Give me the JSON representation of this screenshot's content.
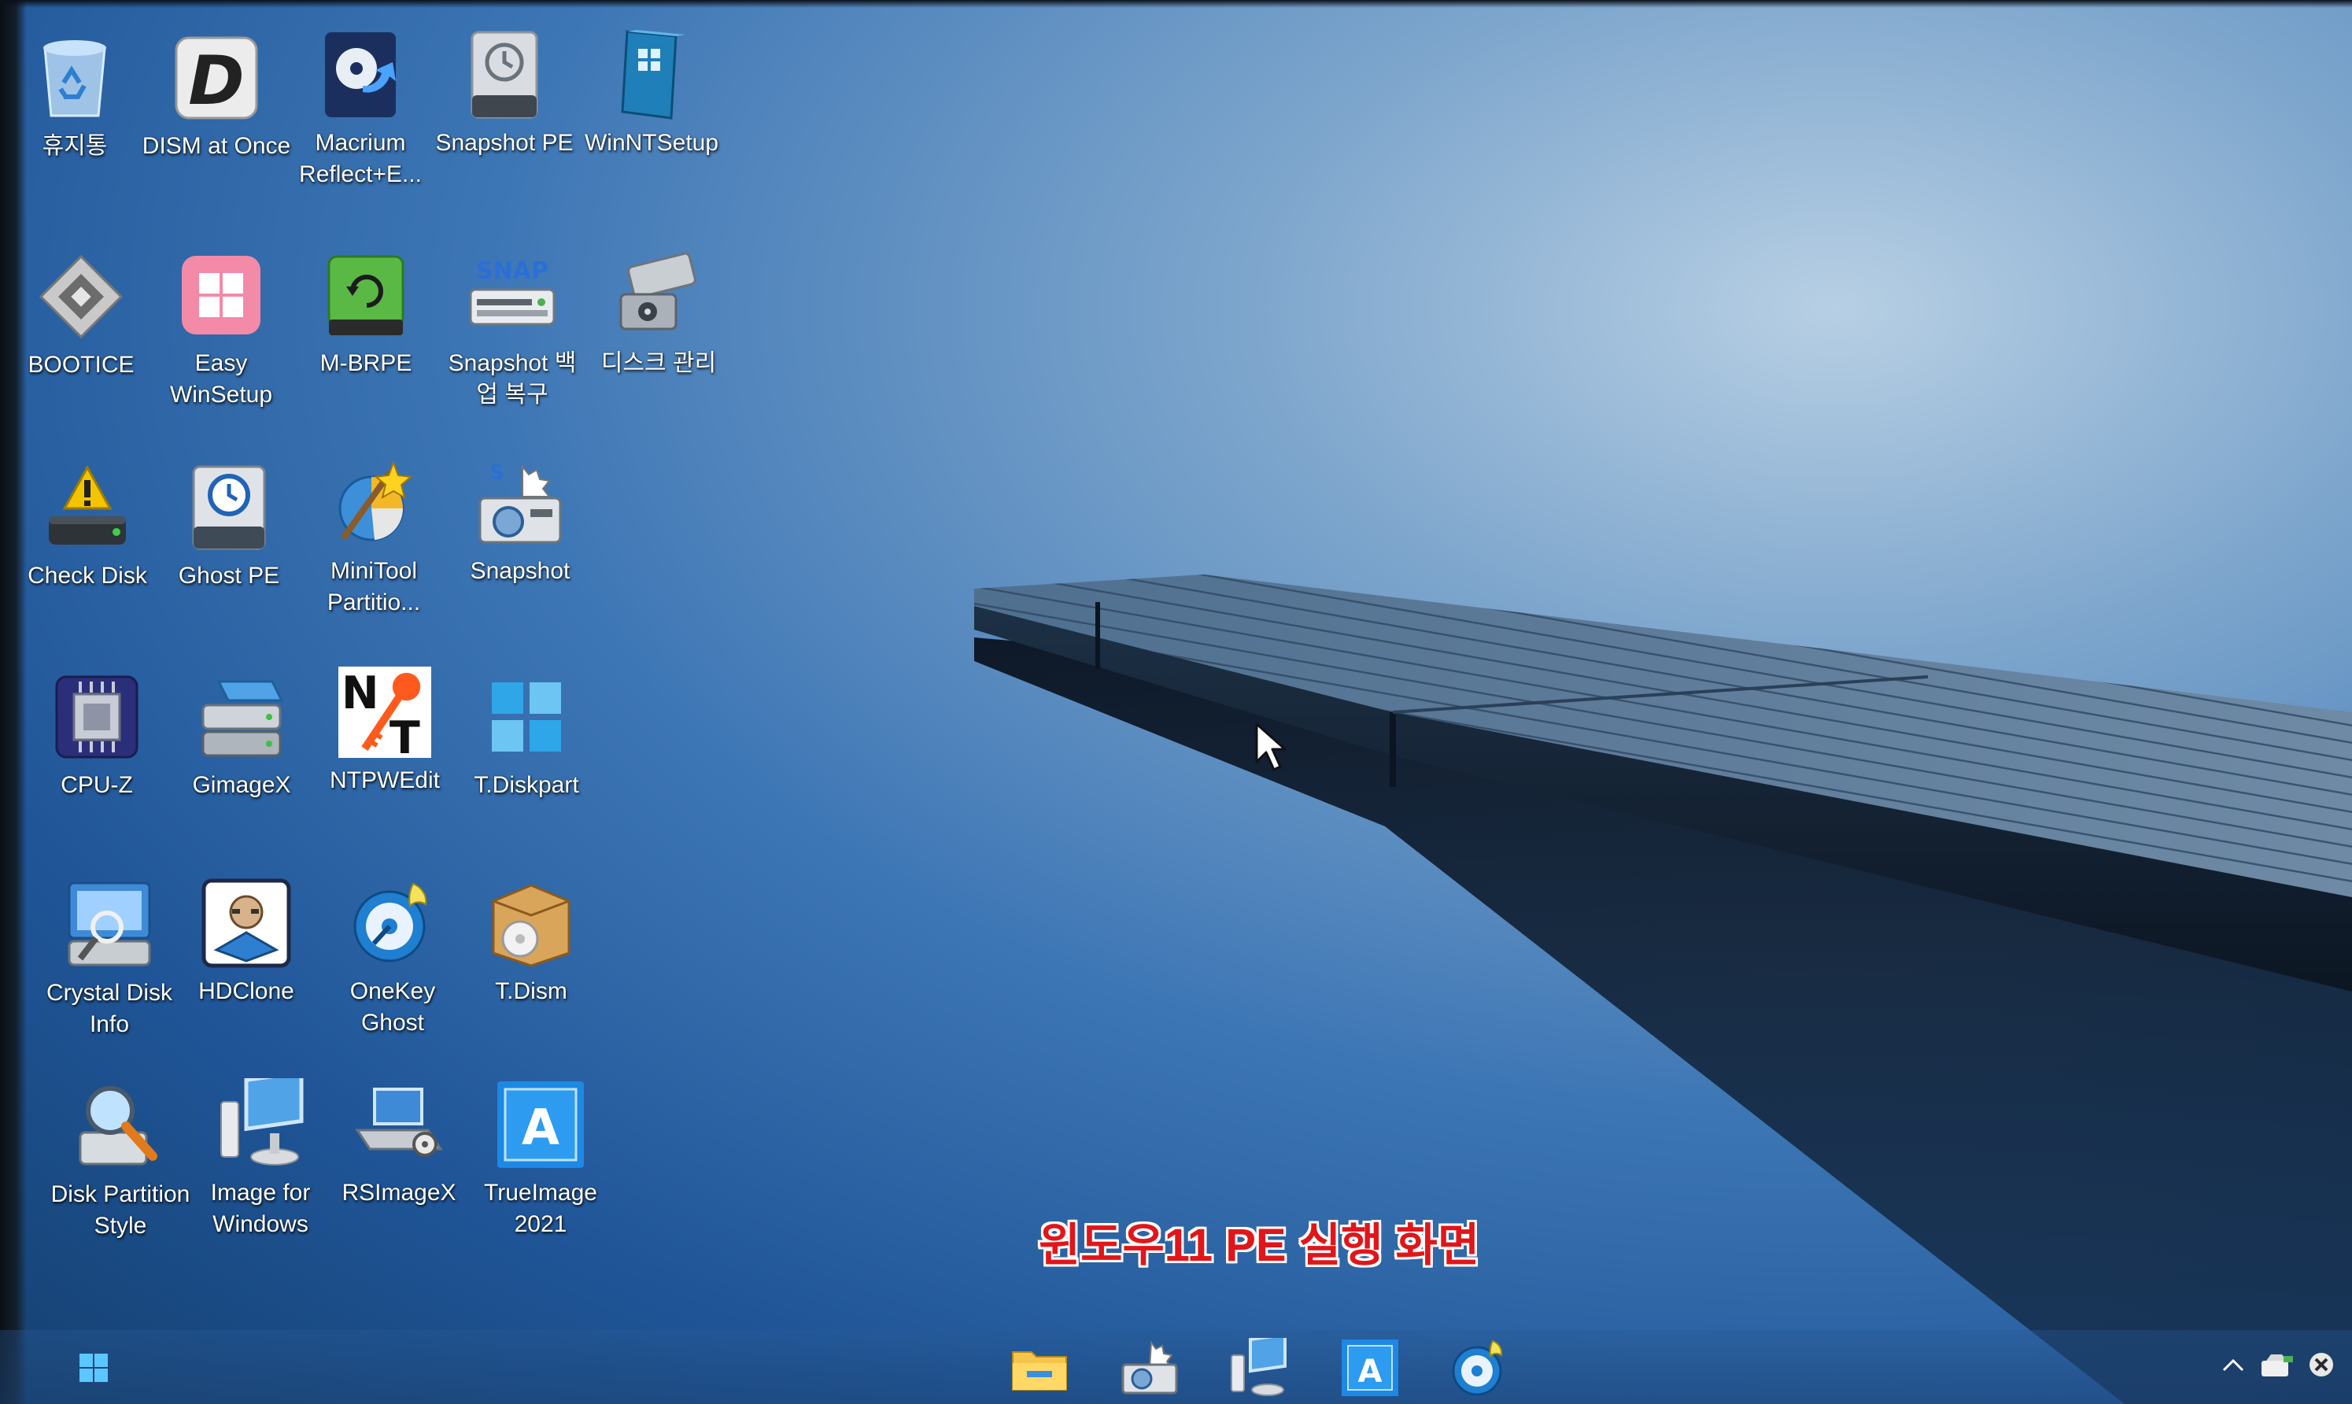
{
  "desktop": {
    "icons": [
      {
        "id": "recycle-bin",
        "label": "휴지통"
      },
      {
        "id": "dism-at-once",
        "label": "DISM at Once"
      },
      {
        "id": "macrium-reflect",
        "label": "Macrium Reflect+E..."
      },
      {
        "id": "snapshot-pe",
        "label": "Snapshot PE"
      },
      {
        "id": "winntsetup",
        "label": "WinNTSetup"
      },
      {
        "id": "bootice",
        "label": "BOOTICE"
      },
      {
        "id": "easy-winsetup",
        "label": "Easy WinSetup"
      },
      {
        "id": "m-brpe",
        "label": "M-BRPE"
      },
      {
        "id": "snapshot-backup-restore",
        "label": "Snapshot 백업 복구"
      },
      {
        "id": "disk-management",
        "label": "디스크 관리"
      },
      {
        "id": "check-disk",
        "label": "Check Disk"
      },
      {
        "id": "ghost-pe",
        "label": "Ghost PE"
      },
      {
        "id": "minitool-partition",
        "label": "MiniTool Partitio..."
      },
      {
        "id": "snapshot",
        "label": "Snapshot"
      },
      {
        "id": "cpu-z",
        "label": "CPU-Z"
      },
      {
        "id": "gimagex",
        "label": "GimageX"
      },
      {
        "id": "ntpwedit",
        "label": "NTPWEdit"
      },
      {
        "id": "t-diskpart",
        "label": "T.Diskpart"
      },
      {
        "id": "crystal-disk-info",
        "label": "Crystal Disk Info"
      },
      {
        "id": "hdclone",
        "label": "HDClone"
      },
      {
        "id": "onekey-ghost",
        "label": "OneKey Ghost"
      },
      {
        "id": "t-dism",
        "label": "T.Dism"
      },
      {
        "id": "disk-partition-style",
        "label": "Disk Partition Style"
      },
      {
        "id": "image-for-windows",
        "label": "Image for Windows"
      },
      {
        "id": "rsimagex",
        "label": "RSImageX"
      },
      {
        "id": "trueimage-2021",
        "label": "TrueImage 2021"
      }
    ],
    "caption": "윈도우11 PE 실행 화면"
  },
  "taskbar": {
    "start_icon": "windows-start-icon",
    "pinned": [
      "file-explorer-icon",
      "snapshot-icon",
      "image-for-windows-icon",
      "trueimage-icon",
      "onekey-ghost-icon"
    ],
    "tray": [
      "chevron-up-icon",
      "usb-eject-icon",
      "close-circle-icon"
    ]
  },
  "colors": {
    "caption": "#e0161a",
    "wallpaper_sky": "#7fa7cd",
    "wallpaper_deep": "#1f5597"
  }
}
